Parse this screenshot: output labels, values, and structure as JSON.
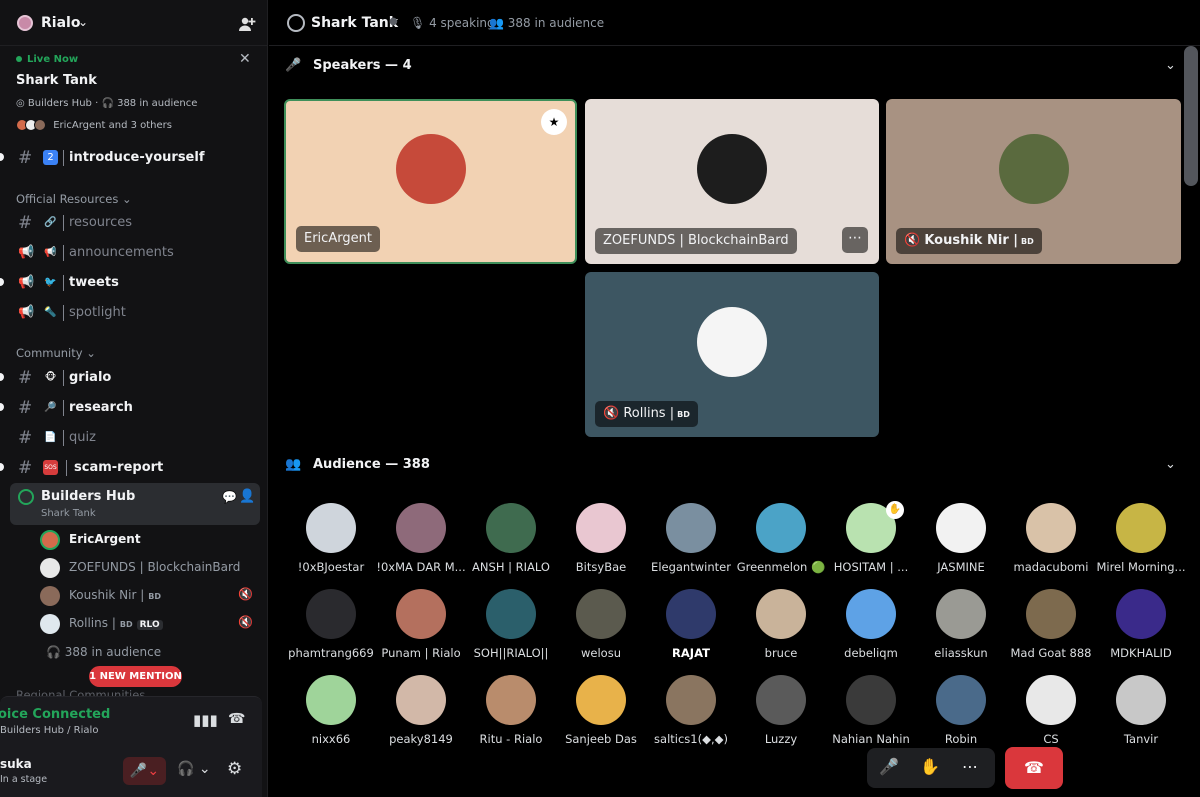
{
  "server": {
    "name": "Rialo",
    "chevron": "⌄",
    "invite_icon": "person-add-icon"
  },
  "live_stage": {
    "label": "Live Now",
    "title": "Shark Tank",
    "channel": "Builders Hub",
    "audience": "388 in audience",
    "speakers": "EricArgent and 3 others",
    "close": "✕"
  },
  "channels_top": [
    {
      "name": "introduce-yourself",
      "emoji": "2",
      "bold": true,
      "unread": true
    }
  ],
  "categories": {
    "official": "Official Resources",
    "community": "Community",
    "regional": "Regional Communities"
  },
  "channels_official": [
    {
      "name": "resources",
      "emoji": "🔗",
      "icon": "#",
      "bold": false
    },
    {
      "name": "announcements",
      "emoji": "📢",
      "icon": "📢",
      "bold": false
    },
    {
      "name": "tweets",
      "emoji": "🐦",
      "icon": "📢",
      "bold": true
    },
    {
      "name": "spotlight",
      "emoji": "🔦",
      "icon": "📢",
      "bold": false
    }
  ],
  "channels_community": [
    {
      "name": "grialo",
      "emoji": "🐵",
      "bold": true
    },
    {
      "name": "research",
      "emoji": "🔎",
      "bold": true
    },
    {
      "name": "quiz",
      "emoji": "📄",
      "bold": false
    },
    {
      "name": "scam-report",
      "emoji": "SOS",
      "bold": true
    }
  ],
  "voice_channel": {
    "name": "Builders Hub",
    "sub": "Shark Tank"
  },
  "voice_users": [
    {
      "name": "EricArgent",
      "active": true,
      "tag": "",
      "muted": false
    },
    {
      "name": "ZOEFUNDS | BlockchainBard",
      "active": false,
      "tag": "",
      "muted": false
    },
    {
      "name": "Koushik Nir |",
      "active": false,
      "tag": "BD",
      "muted": true
    },
    {
      "name": "Rollins |",
      "active": false,
      "tag": "BD",
      "rlo": "RLO",
      "muted": true
    }
  ],
  "voice_audience": "388 in audience",
  "mention_badge": "1 NEW MENTION",
  "voice_status": {
    "connected": "oice Connected",
    "path": "Builders Hub / Rialo"
  },
  "user": {
    "name": "suka",
    "status": "In a stage"
  },
  "header": {
    "title": "Shark Tank",
    "speaking": "4 speaking",
    "audience": "388 in audience"
  },
  "speakers_section": {
    "label": "Speakers — 4"
  },
  "speakers": [
    {
      "name": "EricArgent",
      "tag": ""
    },
    {
      "name": "ZOEFUNDS | BlockchainBard",
      "tag": ""
    },
    {
      "name": "Koushik Nir |",
      "tag": "BD"
    },
    {
      "name": "Rollins |",
      "tag": "BD"
    }
  ],
  "audience_section": {
    "label": "Audience — 388"
  },
  "audience": [
    {
      "name": "!0xBJoestar",
      "color": "#cfd5dc"
    },
    {
      "name": "!0xMA DAR M...",
      "color": "#8e6a7a"
    },
    {
      "name": "ANSH | RIALO",
      "color": "#3f6b4f"
    },
    {
      "name": "BitsyBae",
      "color": "#e9c7d1"
    },
    {
      "name": "Elegantwinter",
      "color": "#7a8fa0"
    },
    {
      "name": "Greenmelon 🟢",
      "color": "#4ba3c7"
    },
    {
      "name": "HOSITAM | ...",
      "color": "#b9e2b0"
    },
    {
      "name": "JASMINE",
      "color": "#f2f2f2"
    },
    {
      "name": "madacubomi",
      "color": "#d9c2a8"
    },
    {
      "name": "Mirel Morning...",
      "color": "#c7b545"
    },
    {
      "name": "phamtrang669",
      "color": "#2a2a2e"
    },
    {
      "name": "Punam | Rialo",
      "color": "#b4705e"
    },
    {
      "name": "SOH||RIALO||",
      "color": "#2b5f6b"
    },
    {
      "name": "welosu",
      "color": "#5b5a4e"
    },
    {
      "name": "RAJAT",
      "color": "#2f3a6b"
    },
    {
      "name": "bruce",
      "color": "#c9b39a"
    },
    {
      "name": "debeliqm",
      "color": "#5ea2e6"
    },
    {
      "name": "eliasskun",
      "color": "#9a9a94"
    },
    {
      "name": "Mad Goat 888",
      "color": "#7d6a4e"
    },
    {
      "name": "MDKHALID",
      "color": "#3a2a8a"
    },
    {
      "name": "nixx66",
      "color": "#9fd49a"
    },
    {
      "name": "peaky8149",
      "color": "#d2b8a8"
    },
    {
      "name": "Ritu - Rialo",
      "color": "#b98c6c"
    },
    {
      "name": "Sanjeeb Das",
      "color": "#e8b24a"
    },
    {
      "name": "saltics1(◆,◆)",
      "color": "#8a7560"
    },
    {
      "name": "Luzzy",
      "color": "#5a5a5a"
    },
    {
      "name": "Nahian Nahin",
      "color": "#3a3a3a"
    },
    {
      "name": "Robin",
      "color": "#4a6a8a"
    },
    {
      "name": "CS",
      "color": "#e8e8e8"
    },
    {
      "name": "Tanvir",
      "color": "#c8c8c8"
    }
  ],
  "controls": {
    "mute": "🎤",
    "hand": "✋",
    "more": "⋯",
    "leave": "☎"
  }
}
